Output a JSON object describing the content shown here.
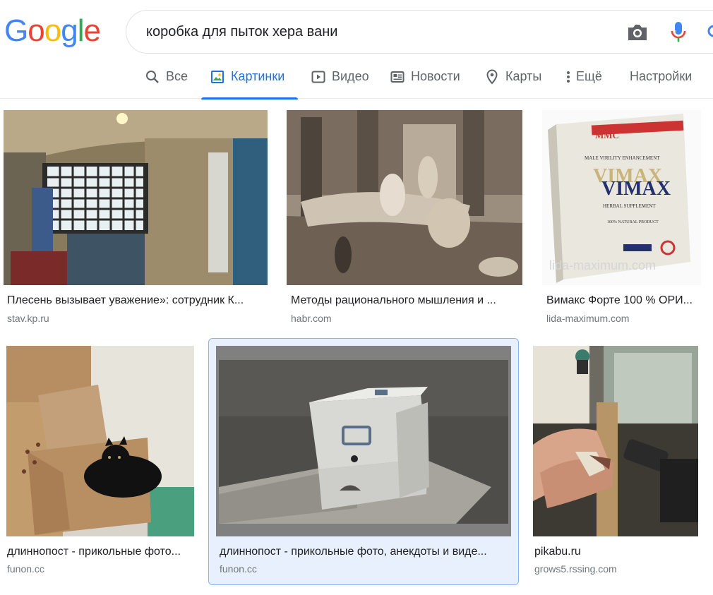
{
  "logo": {
    "text": "Google"
  },
  "search": {
    "query": "коробка для пыток хера вани"
  },
  "tabs": [
    {
      "label": "Все",
      "icon": "search-icon"
    },
    {
      "label": "Картинки",
      "icon": "image-icon"
    },
    {
      "label": "Видео",
      "icon": "video-icon"
    },
    {
      "label": "Новости",
      "icon": "news-icon"
    },
    {
      "label": "Карты",
      "icon": "map-pin-icon"
    },
    {
      "label": "Ещё",
      "icon": "more-vert-icon"
    },
    {
      "label": "Настройки"
    }
  ],
  "results": [
    {
      "caption": "Плесень вызывает уважение»: сотрудник К...",
      "source": "stav.kp.ru"
    },
    {
      "caption": "Методы рационального мышления и ...",
      "source": "habr.com"
    },
    {
      "caption": "Вимакс Форте 100 % ОРИ...",
      "source": "lida-maximum.com"
    },
    {
      "caption": "длиннопост - прикольные фото...",
      "source": "funon.cc"
    },
    {
      "caption": "длиннопост - прикольные фото, анекдоты и виде...",
      "source": "funon.cc"
    },
    {
      "caption": "pikabu.ru",
      "source": "grows5.rssing.com"
    }
  ],
  "product_box": {
    "brand": "MMC",
    "tagline": "MALE VIRILITY ENHANCEMENT",
    "name": "VIMAX",
    "sub": "HERBAL SUPPLEMENT",
    "note": "100% NATURAL PRODUCT",
    "watermark": "lida-maximum.com"
  },
  "colors": {
    "accent": "#1a73e8",
    "selected_bg": "#e8f0fe",
    "selected_border": "#8ab4f8"
  }
}
